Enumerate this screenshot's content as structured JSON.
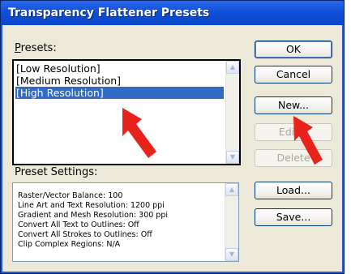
{
  "window": {
    "title": "Transparency Flattener Presets"
  },
  "presets": {
    "label": "Presets:",
    "items": [
      "[Low Resolution]",
      "[Medium Resolution]",
      "[High Resolution]"
    ],
    "selected_index": 2
  },
  "settings": {
    "label": "Preset Settings:",
    "lines": [
      "Raster/Vector Balance: 100",
      "Line Art and Text Resolution: 1200 ppi",
      "Gradient and Mesh Resolution: 300 ppi",
      "Convert All Text to Outlines: Off",
      "Convert All Strokes to Outlines: Off",
      "Clip Complex Regions: N/A"
    ]
  },
  "buttons": {
    "ok": "OK",
    "cancel": "Cancel",
    "new": "New...",
    "edit": "Edit...",
    "delete": "Delete",
    "load": "Load...",
    "save": "Save..."
  },
  "colors": {
    "titlebar": "#0a46c8",
    "selection": "#316ac5",
    "annotation_arrow": "#e8231c"
  },
  "icons": {
    "scroll_up": "scroll-up-icon",
    "scroll_down": "scroll-down-icon",
    "annotation": "red-arrow-icon"
  }
}
